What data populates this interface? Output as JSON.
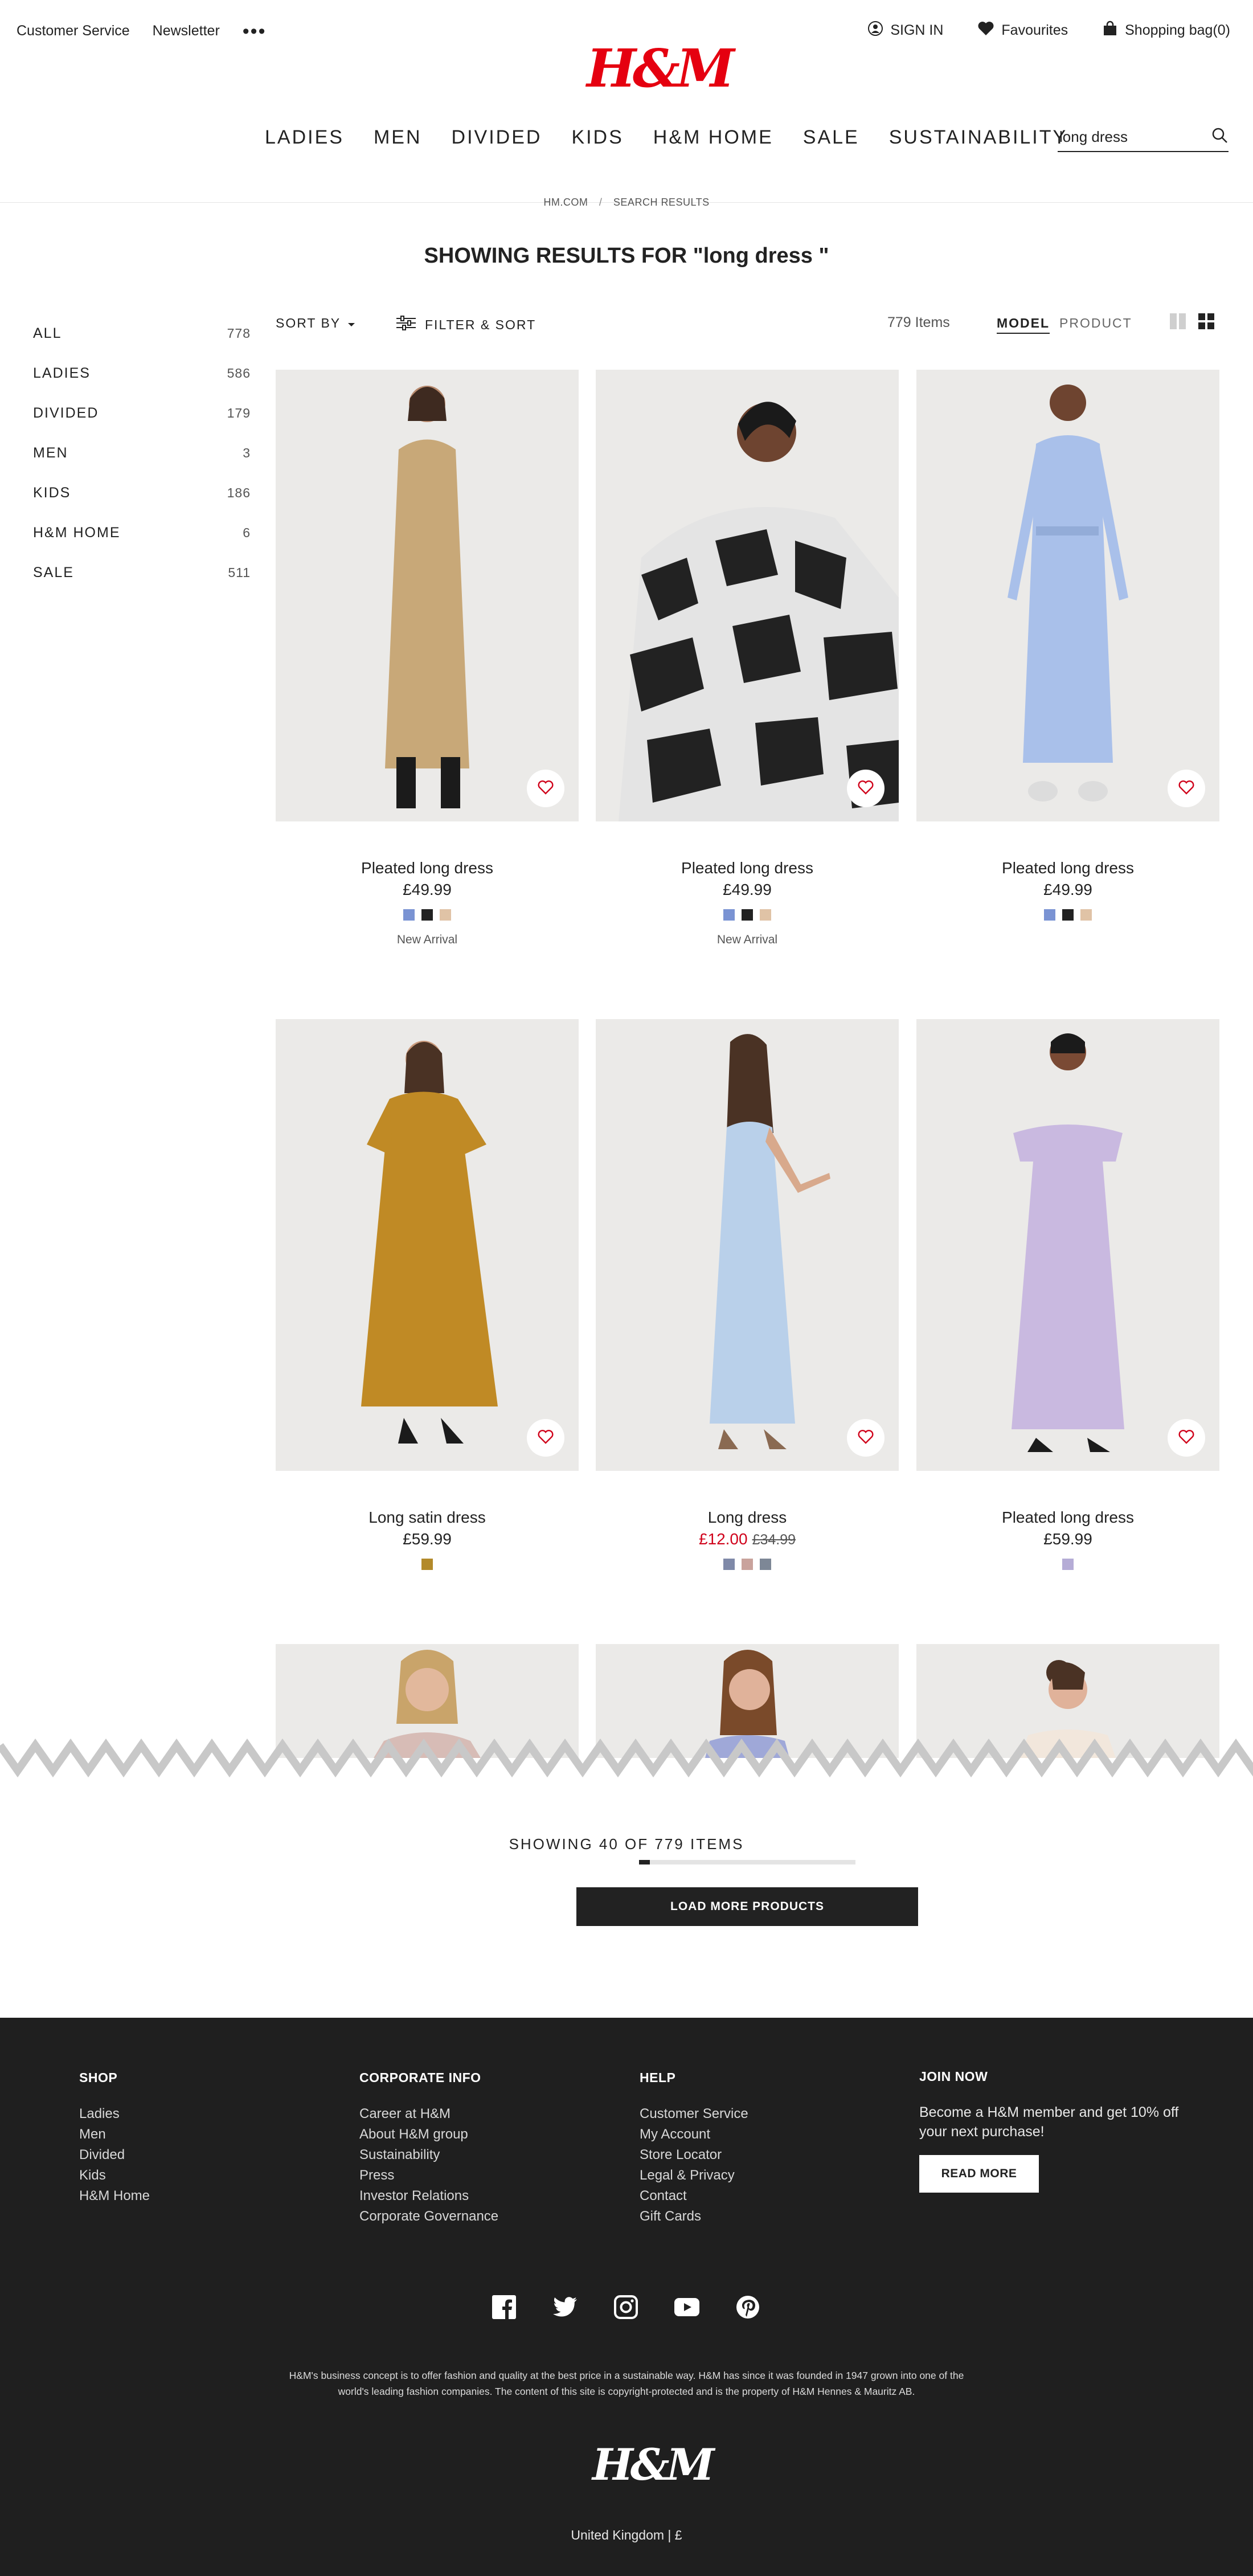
{
  "header": {
    "customer_service": "Customer Service",
    "newsletter": "Newsletter",
    "more": "•••",
    "sign_in": "SIGN IN",
    "favourites": "Favourites",
    "shopping_bag": "Shopping bag(0)",
    "logo": "H&M",
    "logo_color": "#e50010",
    "nav": [
      "LADIES",
      "MEN",
      "DIVIDED",
      "KIDS",
      "H&M HOME",
      "SALE",
      "SUSTAINABILITY"
    ],
    "search_value": "long dress"
  },
  "breadcrumb": {
    "home": "HM.COM",
    "sep": "/",
    "current": "SEARCH RESULTS"
  },
  "results_title": "SHOWING RESULTS FOR \"long dress \"",
  "sidebar": [
    {
      "label": "ALL",
      "count": "778"
    },
    {
      "label": "LADIES",
      "count": "586"
    },
    {
      "label": "DIVIDED",
      "count": "179"
    },
    {
      "label": "MEN",
      "count": "3"
    },
    {
      "label": "KIDS",
      "count": "186"
    },
    {
      "label": "H&M HOME",
      "count": "6"
    },
    {
      "label": "SALE",
      "count": "511"
    }
  ],
  "toolbar": {
    "sort_by": "SORT BY",
    "filter_sort": "FILTER & SORT",
    "items_count": "779 Items",
    "view_model": "MODEL",
    "view_product": "PRODUCT"
  },
  "products": [
    {
      "name": "Pleated long dress",
      "price": "£49.99",
      "badge": "New Arrival",
      "swatches": [
        "#7a93d3",
        "#222222",
        "#e0c3a6"
      ],
      "dress_color": "#c8a878"
    },
    {
      "name": "Pleated long dress",
      "price": "£49.99",
      "badge": "New Arrival",
      "swatches": [
        "#7a93d3",
        "#222222",
        "#e0c3a6"
      ],
      "dress_color": "#3a3a3a"
    },
    {
      "name": "Pleated long dress",
      "price": "£49.99",
      "badge": "",
      "swatches": [
        "#7a93d3",
        "#222222",
        "#e0c3a6"
      ],
      "dress_color": "#a9c0ea"
    },
    {
      "name": "Long satin dress",
      "price": "£59.99",
      "badge": "",
      "swatches": [
        "#b38a2a"
      ],
      "dress_color": "#c08a25"
    },
    {
      "name": "Long dress",
      "price": "£12.00",
      "old_price": "£34.99",
      "badge": "",
      "swatches": [
        "#7f89a8",
        "#c9a29c",
        "#7d8796"
      ],
      "dress_color": "#b9d0ea"
    },
    {
      "name": "Pleated long dress",
      "price": "£59.99",
      "badge": "",
      "swatches": [
        "#b5acd6"
      ],
      "dress_color": "#c9b9e0"
    }
  ],
  "load_more": {
    "showing": "SHOWING 40 OF 779 ITEMS",
    "progress": 0.051,
    "button": "LOAD MORE PRODUCTS"
  },
  "footer": {
    "shop": {
      "title": "SHOP",
      "links": [
        "Ladies",
        "Men",
        "Divided",
        "Kids",
        "H&M Home"
      ]
    },
    "corporate": {
      "title": "CORPORATE INFO",
      "links": [
        "Career at H&M",
        "About H&M group",
        "Sustainability",
        "Press",
        "Investor Relations",
        "Corporate Governance"
      ]
    },
    "help": {
      "title": "HELP",
      "links": [
        "Customer Service",
        "My Account",
        "Store Locator",
        "Legal & Privacy",
        "Contact",
        "Gift Cards"
      ]
    },
    "join": {
      "title": "JOIN NOW",
      "text": "Become a H&M member and get 10% off your next purchase!",
      "button": "READ MORE"
    },
    "socials": [
      "facebook-icon",
      "twitter-icon",
      "instagram-icon",
      "youtube-icon",
      "pinterest-icon"
    ],
    "legal": "H&M's business concept is to offer fashion and quality at the best price in a sustainable way. H&M has since it was founded in 1947 grown into one of the world's leading fashion companies. The content of this site is copyright-protected and is the property of H&M Hennes & Mauritz AB.",
    "logo": "H&M",
    "region": "United Kingdom | £"
  }
}
